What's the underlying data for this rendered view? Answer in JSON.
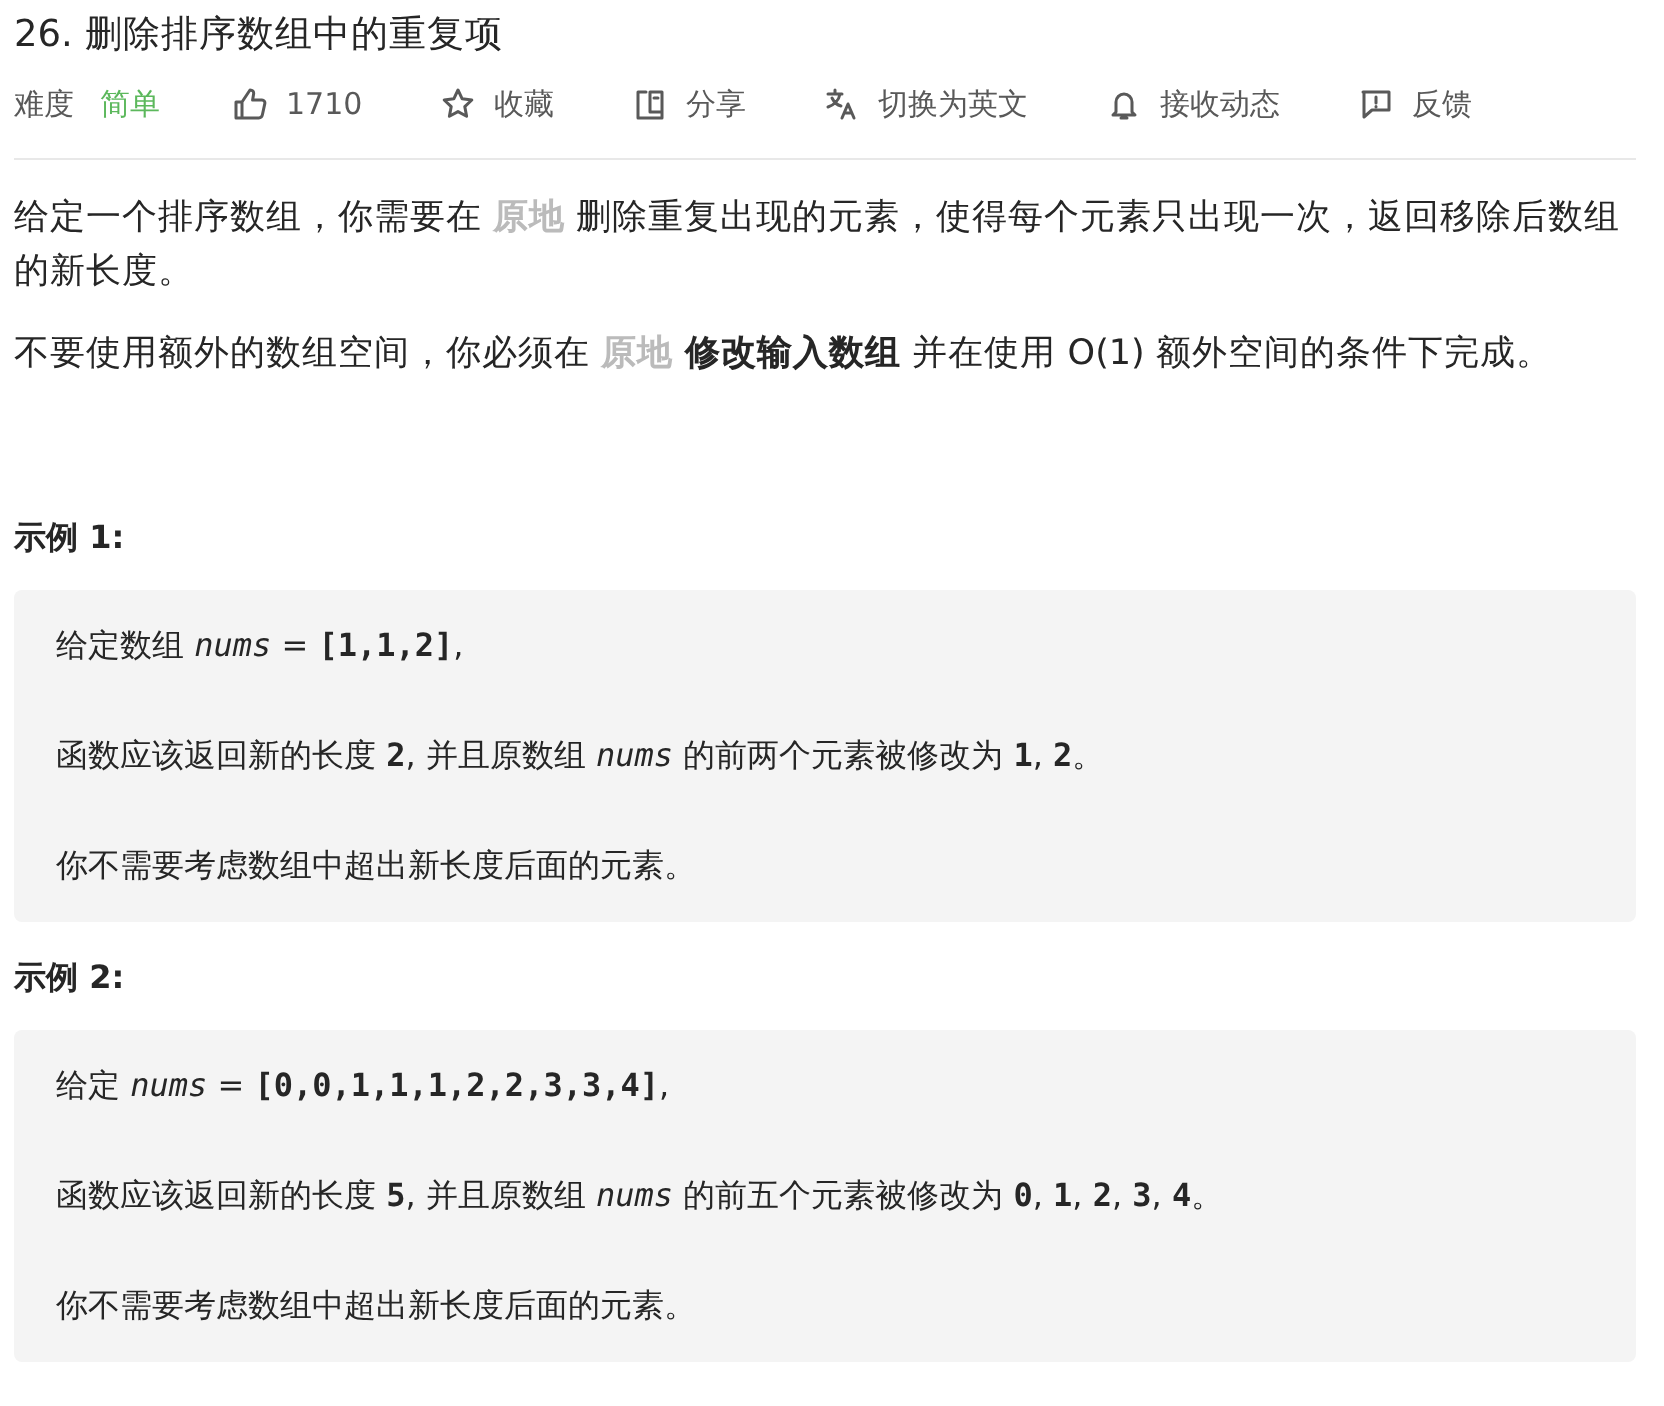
{
  "title": "26. 删除排序数组中的重复项",
  "meta": {
    "difficulty_label": "难度",
    "difficulty": "简单",
    "actions": [
      {
        "kind": "like",
        "label": "1710"
      },
      {
        "kind": "favorite",
        "label": "收藏"
      },
      {
        "kind": "share",
        "label": "分享"
      },
      {
        "kind": "translate",
        "label": "切换为英文"
      },
      {
        "kind": "subscribe",
        "label": "接收动态"
      },
      {
        "kind": "feedback",
        "label": "反馈"
      }
    ]
  },
  "description": [
    {
      "segments": [
        {
          "kind": "plain",
          "text": "给定一个排序数组，你需要在 "
        },
        {
          "kind": "highlight",
          "text": "原地"
        },
        {
          "kind": "plain",
          "text": " 删除重复出现的元素，使得每个元素只出现一次，返回移除后数组的新长度。"
        }
      ]
    },
    {
      "segments": [
        {
          "kind": "plain",
          "text": "不要使用额外的数组空间，你必须在 "
        },
        {
          "kind": "highlight",
          "text": "原地"
        },
        {
          "kind": "bold",
          "text": " 修改输入数组"
        },
        {
          "kind": "plain",
          "text": " 并在使用 O(1) 额外空间的条件下完成。"
        }
      ]
    }
  ],
  "examples": [
    {
      "heading": "示例 1:",
      "lines": [
        [
          {
            "kind": "text",
            "text": "给定数组 "
          },
          {
            "kind": "var",
            "text": "nums"
          },
          {
            "kind": "text",
            "text": " = "
          },
          {
            "kind": "code",
            "text": "[1,1,2]"
          },
          {
            "kind": "text",
            "text": ", "
          }
        ],
        [
          {
            "kind": "text",
            "text": "函数应该返回新的长度 "
          },
          {
            "kind": "code",
            "text": "2"
          },
          {
            "kind": "text",
            "text": ", 并且原数组 "
          },
          {
            "kind": "var",
            "text": "nums"
          },
          {
            "kind": "text",
            "text": " 的前两个元素被修改为 "
          },
          {
            "kind": "code",
            "text": "1"
          },
          {
            "kind": "text",
            "text": ", "
          },
          {
            "kind": "code",
            "text": "2"
          },
          {
            "kind": "text",
            "text": "。"
          }
        ],
        [
          {
            "kind": "text",
            "text": "你不需要考虑数组中超出新长度后面的元素。"
          }
        ]
      ]
    },
    {
      "heading": "示例 2:",
      "lines": [
        [
          {
            "kind": "text",
            "text": "给定 "
          },
          {
            "kind": "var",
            "text": "nums"
          },
          {
            "kind": "text",
            "text": " = "
          },
          {
            "kind": "code",
            "text": "[0,0,1,1,1,2,2,3,3,4]"
          },
          {
            "kind": "text",
            "text": ","
          }
        ],
        [
          {
            "kind": "text",
            "text": "函数应该返回新的长度 "
          },
          {
            "kind": "code",
            "text": "5"
          },
          {
            "kind": "text",
            "text": ", 并且原数组 "
          },
          {
            "kind": "var",
            "text": "nums"
          },
          {
            "kind": "text",
            "text": " 的前五个元素被修改为 "
          },
          {
            "kind": "code",
            "text": "0"
          },
          {
            "kind": "text",
            "text": ", "
          },
          {
            "kind": "code",
            "text": "1"
          },
          {
            "kind": "text",
            "text": ", "
          },
          {
            "kind": "code",
            "text": "2"
          },
          {
            "kind": "text",
            "text": ", "
          },
          {
            "kind": "code",
            "text": "3"
          },
          {
            "kind": "text",
            "text": ", "
          },
          {
            "kind": "code",
            "text": "4"
          },
          {
            "kind": "text",
            "text": "。"
          }
        ],
        [
          {
            "kind": "text",
            "text": "你不需要考虑数组中超出新长度后面的元素。"
          }
        ]
      ]
    }
  ]
}
